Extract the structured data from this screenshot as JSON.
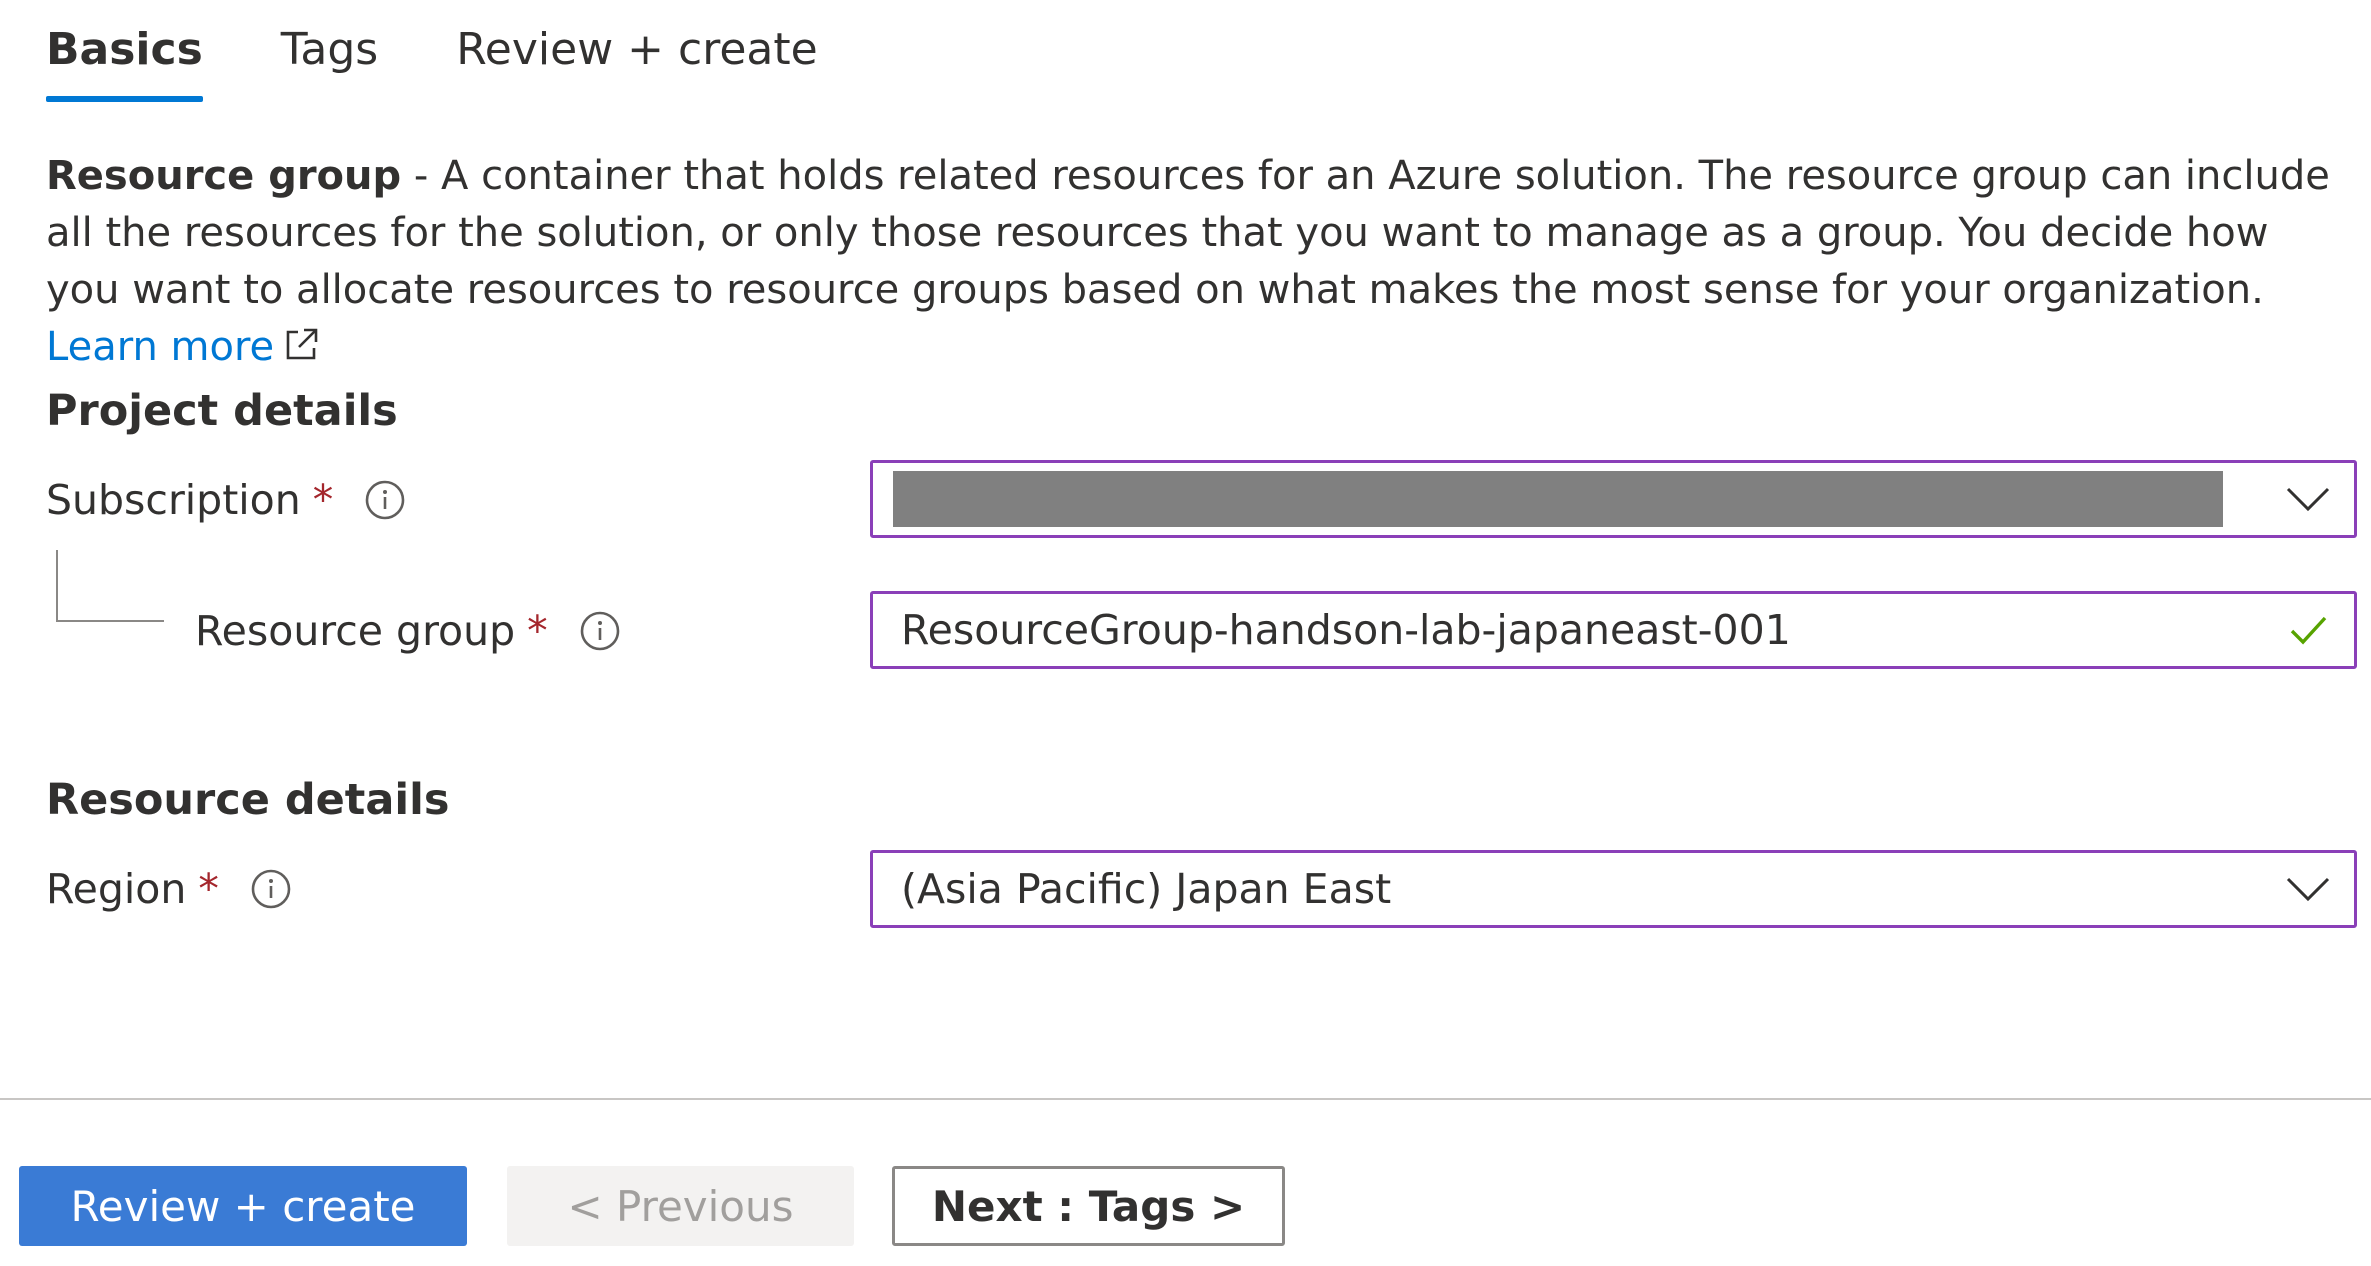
{
  "tabs": [
    {
      "label": "Basics"
    },
    {
      "label": "Tags"
    },
    {
      "label": "Review + create"
    }
  ],
  "description": {
    "term": "Resource group",
    "text": " - A container that holds related resources for an Azure solution. The resource group can include all the resources for the solution, or only those resources that you want to manage as a group. You decide how you want to allocate resources to resource groups based on what makes the most sense for your organization. ",
    "learn_more": "Learn more"
  },
  "project_details": {
    "title": "Project details",
    "subscription": {
      "label": "Subscription",
      "required_mark": "*"
    },
    "resource_group": {
      "label": "Resource group",
      "required_mark": "*",
      "value": "ResourceGroup-handson-lab-japaneast-001"
    }
  },
  "resource_details": {
    "title": "Resource details",
    "region": {
      "label": "Region",
      "required_mark": "*",
      "value": "(Asia Pacific) Japan East"
    }
  },
  "footer": {
    "review_create": "Review + create",
    "previous": "< Previous",
    "next": "Next : Tags >"
  },
  "colors": {
    "accent": "#0078d4",
    "primary_button": "#3a7bd5",
    "required": "#a4262c",
    "focus_border": "#8a3fb8",
    "valid_check": "#57a300"
  },
  "icons": {
    "info": "info-icon",
    "external_link": "external-link-icon",
    "dropdown": "chevron-down-icon",
    "valid": "checkmark-icon"
  }
}
